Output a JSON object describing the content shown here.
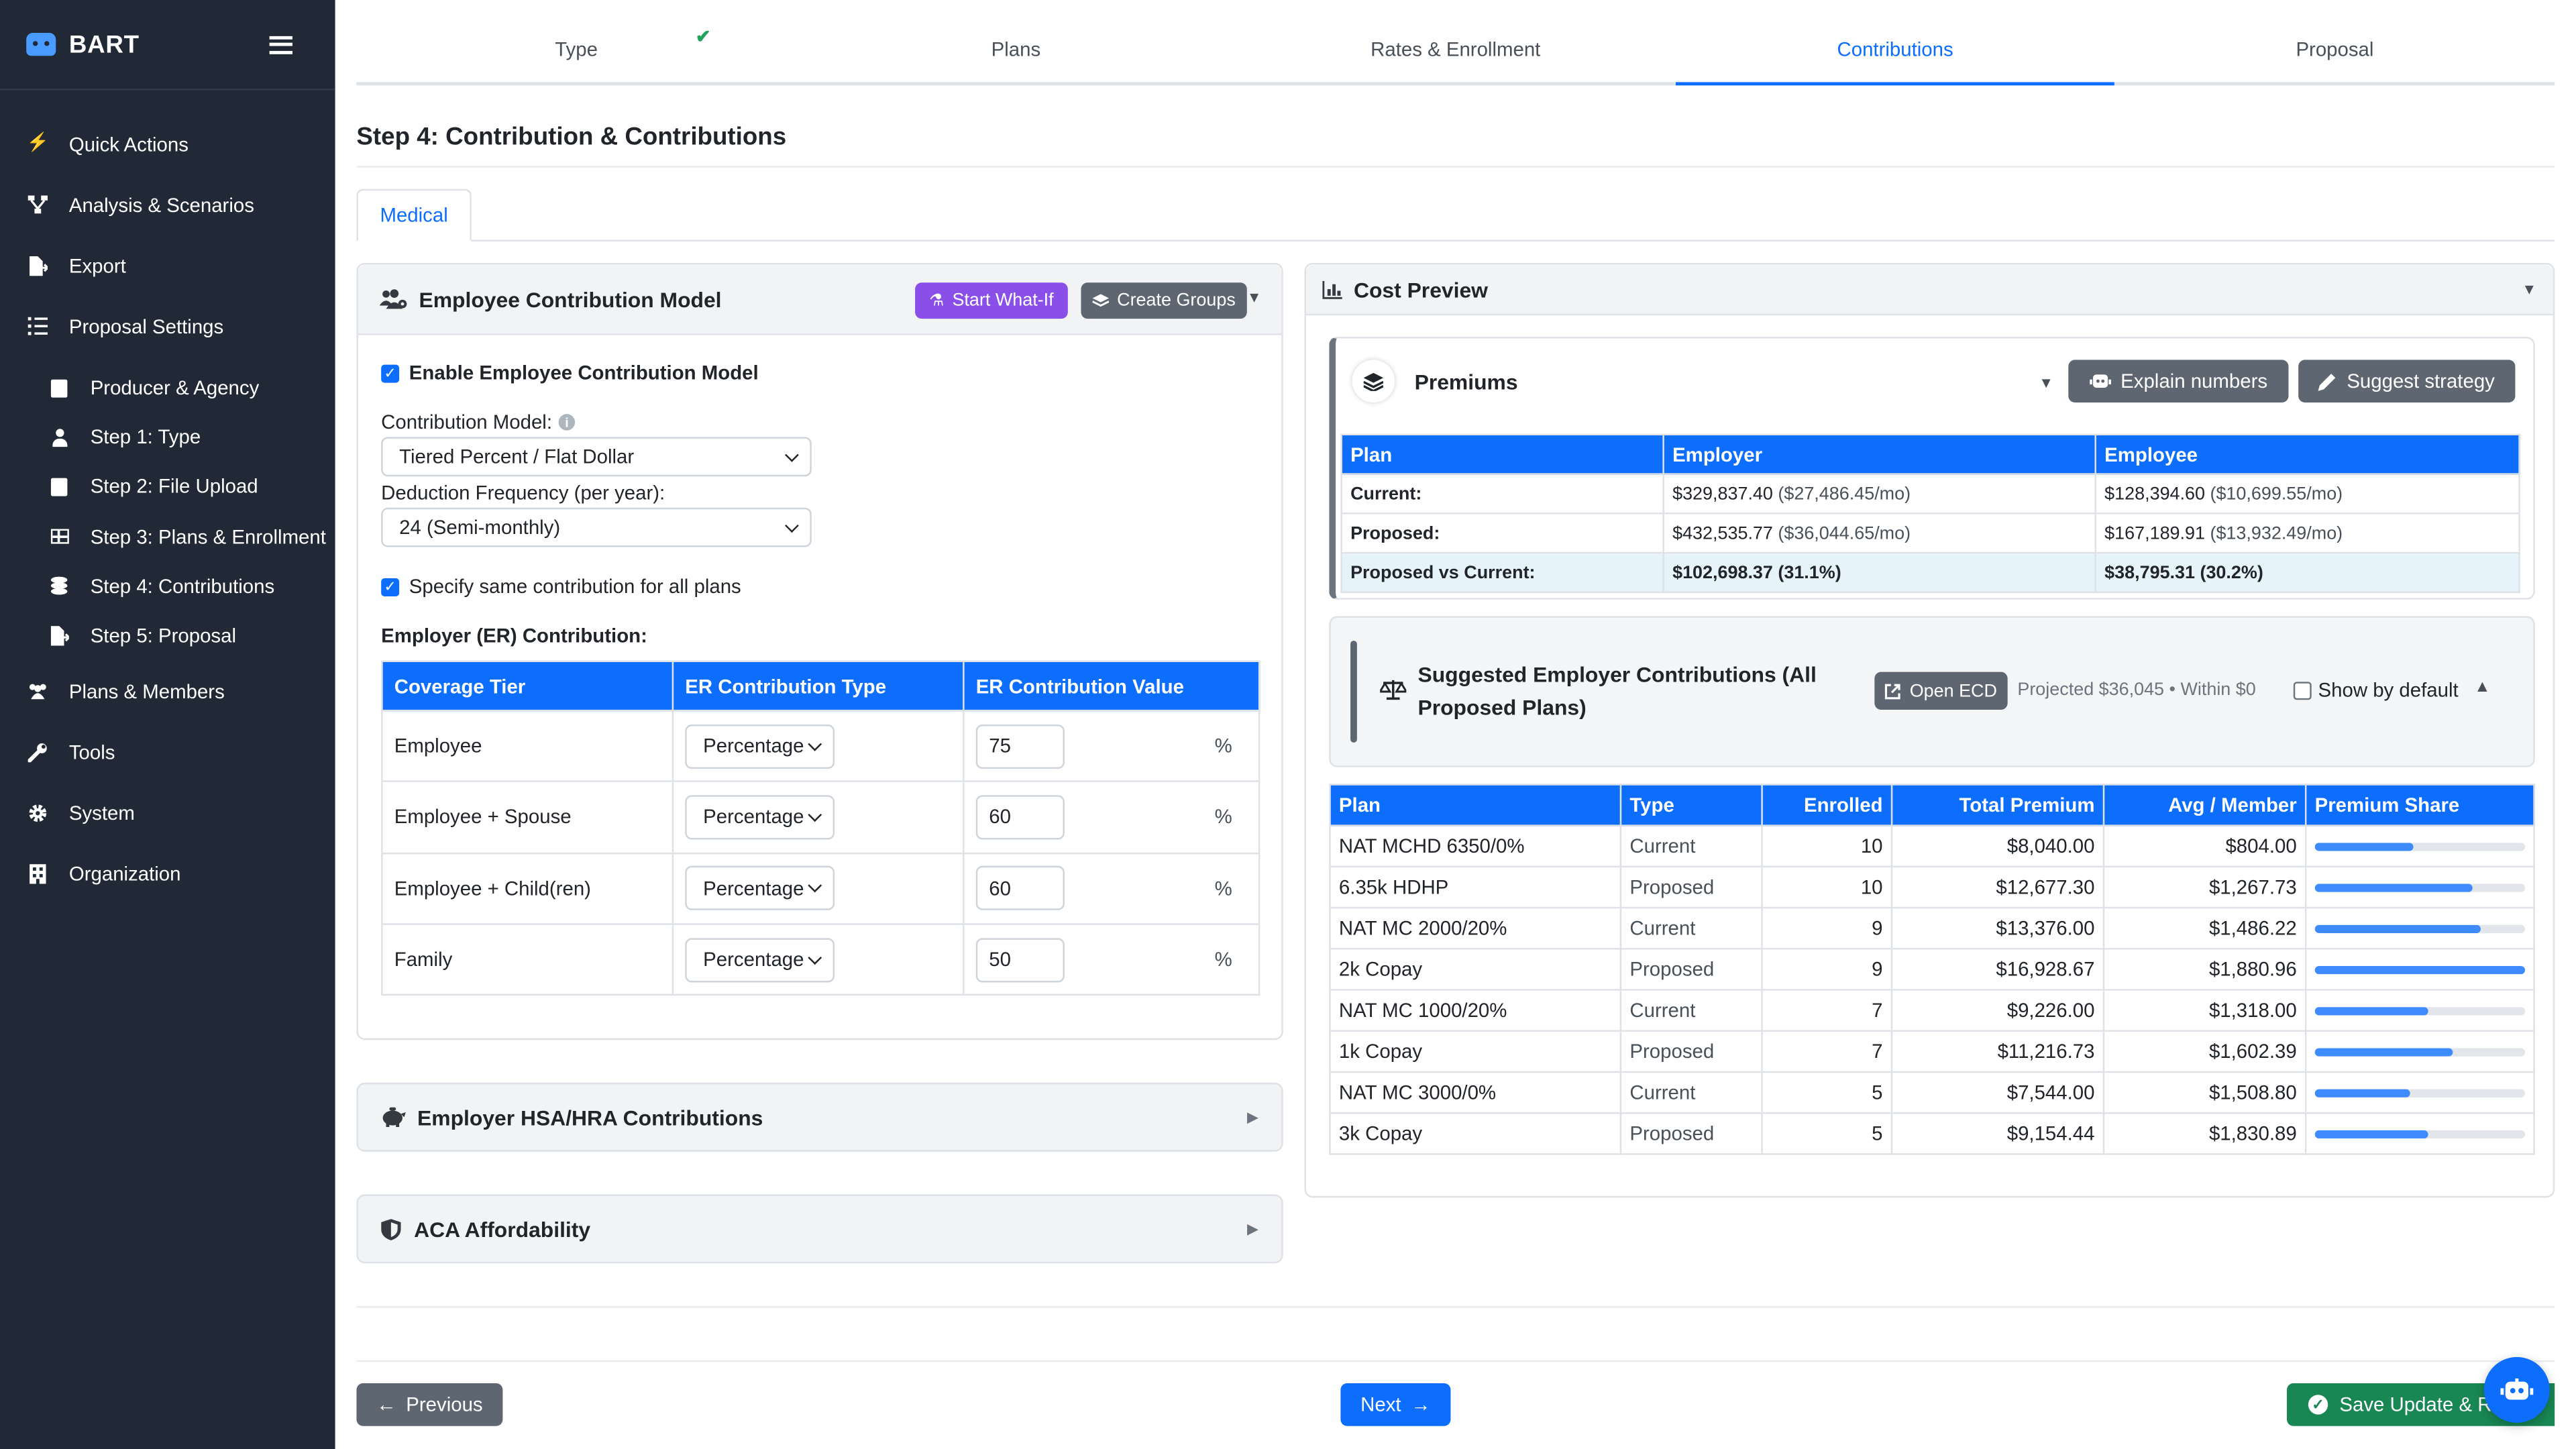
{
  "app": {
    "name": "BART"
  },
  "sidebar": {
    "items": [
      {
        "label": "Quick Actions",
        "icon": "bolt-icon"
      },
      {
        "label": "Analysis & Scenarios",
        "icon": "sitemap-icon"
      },
      {
        "label": "Export",
        "icon": "file-export-icon"
      },
      {
        "label": "Proposal Settings",
        "icon": "list-icon"
      }
    ],
    "sub_items": [
      {
        "label": "Producer & Agency",
        "icon": "id-badge-icon"
      },
      {
        "label": "Step 1: Type",
        "icon": "user-icon"
      },
      {
        "label": "Step 2: File Upload",
        "icon": "file-icon"
      },
      {
        "label": "Step 3: Plans & Enrollment",
        "icon": "table-icon"
      },
      {
        "label": "Step 4: Contributions",
        "icon": "coins-icon"
      },
      {
        "label": "Step 5: Proposal",
        "icon": "file-export-icon"
      }
    ],
    "items_after": [
      {
        "label": "Plans & Members",
        "icon": "users-icon"
      },
      {
        "label": "Tools",
        "icon": "wrench-icon"
      },
      {
        "label": "System",
        "icon": "gear-icon"
      },
      {
        "label": "Organization",
        "icon": "building-icon"
      }
    ]
  },
  "wizard": {
    "steps": [
      "Type",
      "Plans",
      "Rates & Enrollment",
      "Contributions",
      "Proposal"
    ],
    "active_index": 3,
    "completed_mark": "✔"
  },
  "page": {
    "title": "Step 4: Contribution & Contributions",
    "tab": "Medical"
  },
  "contribution_model": {
    "title": "Employee Contribution Model",
    "start_whatif": "Start What-If",
    "create_groups": "Create Groups",
    "enable_label": "Enable Employee Contribution Model",
    "enable_checked": true,
    "model_label": "Contribution Model:",
    "model_value": "Tiered Percent / Flat Dollar",
    "frequency_label": "Deduction Frequency (per year):",
    "frequency_value": "24 (Semi-monthly)",
    "same_label": "Specify same contribution for all plans",
    "same_checked": true,
    "er_heading": "Employer (ER) Contribution:",
    "table_headers": [
      "Coverage Tier",
      "ER Contribution Type",
      "ER Contribution Value"
    ],
    "rows": [
      {
        "tier": "Employee",
        "type": "Percentage",
        "value": "75",
        "unit": "%"
      },
      {
        "tier": "Employee + Spouse",
        "type": "Percentage",
        "value": "60",
        "unit": "%"
      },
      {
        "tier": "Employee + Child(ren)",
        "type": "Percentage",
        "value": "60",
        "unit": "%"
      },
      {
        "tier": "Family",
        "type": "Percentage",
        "value": "50",
        "unit": "%"
      }
    ]
  },
  "hsa": {
    "title": "Employer HSA/HRA Contributions"
  },
  "aca": {
    "title": "ACA Affordability"
  },
  "cost_preview": {
    "title": "Cost Preview",
    "premiums_title": "Premiums",
    "explain_button": "Explain numbers",
    "suggest_button": "Suggest strategy",
    "premium_headers": [
      "Plan",
      "Employer",
      "Employee"
    ],
    "premium_rows": [
      {
        "label": "Current:",
        "er": "$329,837.40",
        "er_mo": "($27,486.45/mo)",
        "ee": "$128,394.60",
        "ee_mo": "($10,699.55/mo)"
      },
      {
        "label": "Proposed:",
        "er": "$432,535.77",
        "er_mo": "($36,044.65/mo)",
        "ee": "$167,189.91",
        "ee_mo": "($13,932.49/mo)"
      }
    ],
    "diff_row": {
      "label": "Proposed vs Current:",
      "er": "$102,698.37 (31.1%)",
      "ee": "$38,795.31 (30.2%)"
    },
    "suggested": {
      "title_line1": "Suggested Employer Contributions (All",
      "title_line2": "Proposed Plans)",
      "open_ecd": "Open ECD",
      "projected": "Projected $36,045 • Within $0",
      "show_default": "Show by default",
      "show_default_checked": false
    },
    "plan_headers": [
      "Plan",
      "Type",
      "Enrolled",
      "Total Premium",
      "Avg / Member",
      "Premium Share"
    ],
    "plans": [
      {
        "plan": "NAT MCHD 6350/0%",
        "type": "Current",
        "enrolled": "10",
        "total": "$8,040.00",
        "avg": "$804.00",
        "share": 0.47
      },
      {
        "plan": "6.35k HDHP",
        "type": "Proposed",
        "enrolled": "10",
        "total": "$12,677.30",
        "avg": "$1,267.73",
        "share": 0.75
      },
      {
        "plan": "NAT MC 2000/20%",
        "type": "Current",
        "enrolled": "9",
        "total": "$13,376.00",
        "avg": "$1,486.22",
        "share": 0.79
      },
      {
        "plan": "2k Copay",
        "type": "Proposed",
        "enrolled": "9",
        "total": "$16,928.67",
        "avg": "$1,880.96",
        "share": 1.0
      },
      {
        "plan": "NAT MC 1000/20%",
        "type": "Current",
        "enrolled": "7",
        "total": "$9,226.00",
        "avg": "$1,318.00",
        "share": 0.54
      },
      {
        "plan": "1k Copay",
        "type": "Proposed",
        "enrolled": "7",
        "total": "$11,216.73",
        "avg": "$1,602.39",
        "share": 0.66
      },
      {
        "plan": "NAT MC 3000/0%",
        "type": "Current",
        "enrolled": "5",
        "total": "$7,544.00",
        "avg": "$1,508.80",
        "share": 0.45
      },
      {
        "plan": "3k Copay",
        "type": "Proposed",
        "enrolled": "5",
        "total": "$9,154.44",
        "avg": "$1,830.89",
        "share": 0.54
      }
    ]
  },
  "footer": {
    "previous": "Previous",
    "next": "Next",
    "save": "Save Update & R"
  },
  "colors": {
    "sidebar": "#212936",
    "accent": "#0d6efd",
    "purple": "#8a4fe8",
    "green": "#198754",
    "danger": "#dc3545"
  }
}
